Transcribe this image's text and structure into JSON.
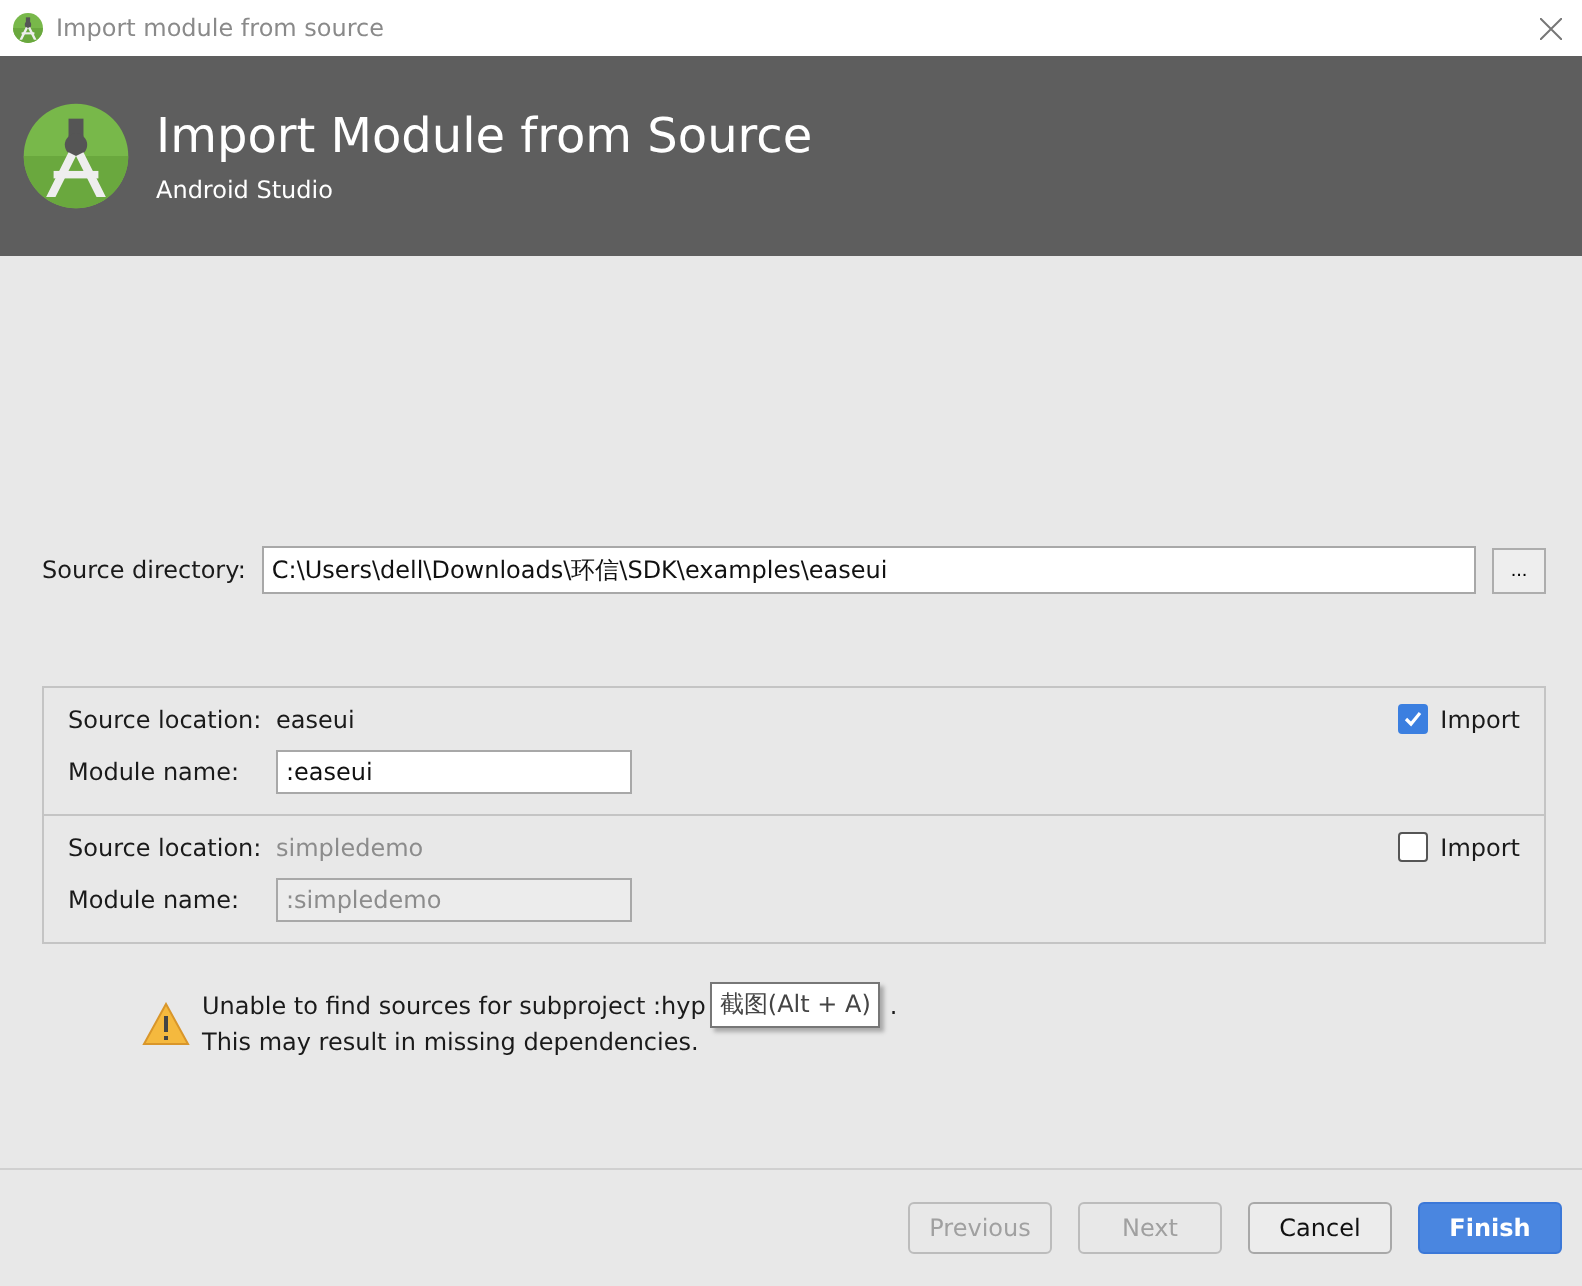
{
  "window": {
    "title": "Import module from source"
  },
  "header": {
    "title": "Import Module from Source",
    "subtitle": "Android Studio"
  },
  "source_directory": {
    "label": "Source directory:",
    "value": "C:\\Users\\dell\\Downloads\\环信\\SDK\\examples\\easeui",
    "browse": "..."
  },
  "modules": [
    {
      "location_label": "Source location:",
      "location": "easeui",
      "name_label": "Module name:",
      "name": ":easeui",
      "import_label": "Import",
      "checked": true
    },
    {
      "location_label": "Source location:",
      "location": "simpledemo",
      "name_label": "Module name:",
      "name": ":simpledemo",
      "import_label": "Import",
      "checked": false
    }
  ],
  "warning": {
    "line1_start": "Unable to find sources for subproject :hyp",
    "line1_end": ".",
    "line2": "This may result in missing dependencies."
  },
  "tooltip": "截图(Alt + A)",
  "buttons": [
    {
      "label": "Previous",
      "disabled": true,
      "primary": false
    },
    {
      "label": "Next",
      "disabled": true,
      "primary": false
    },
    {
      "label": "Cancel",
      "disabled": false,
      "primary": false
    },
    {
      "label": "Finish",
      "disabled": false,
      "primary": true
    }
  ]
}
